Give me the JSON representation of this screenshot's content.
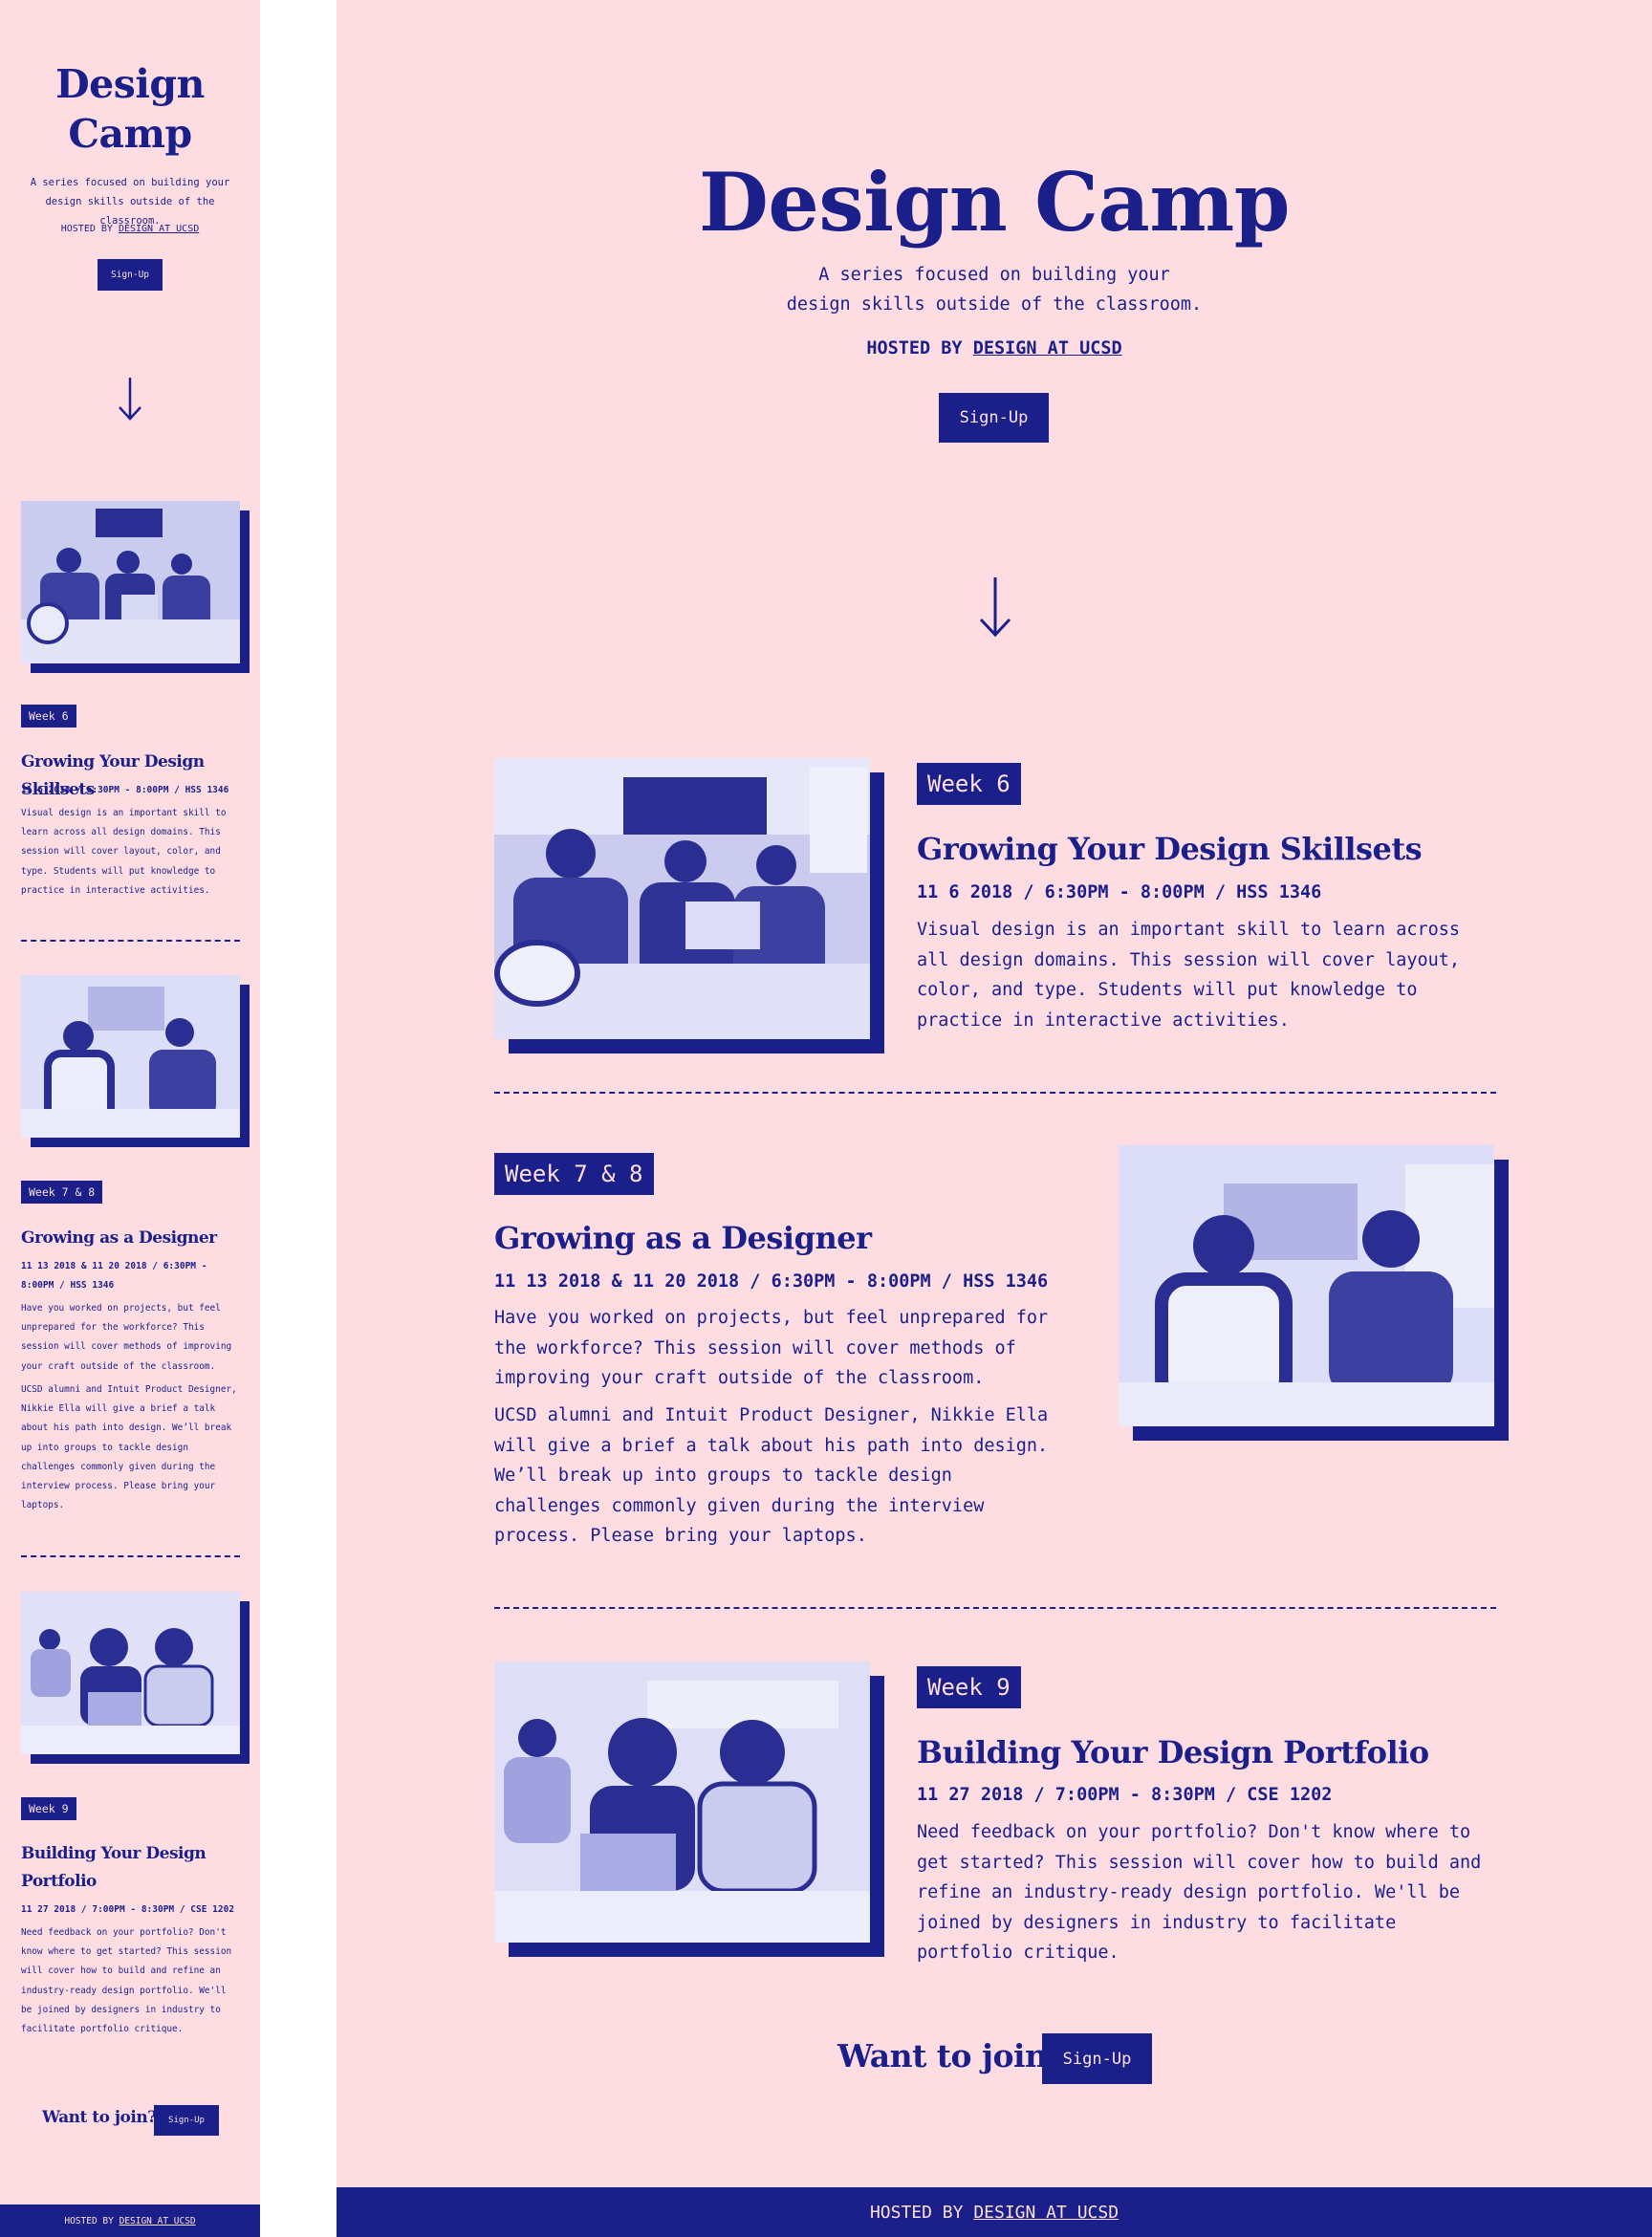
{
  "brand": {
    "primary": "#1b1f8a",
    "background": "#fddde1",
    "on_primary": "#fde0e3"
  },
  "hero": {
    "title": "Design Camp",
    "subtitle": "A series focused on building your design skills outside of the classroom.",
    "hosted_prefix": "HOSTED BY ",
    "hosted_link": "DESIGN AT UCSD",
    "signup_label": "Sign-Up",
    "scroll_icon": "arrow-down-icon"
  },
  "sessions": [
    {
      "week": "Week 6",
      "title": "Growing Your Design Skillsets",
      "meta": "11 6 2018 / 6:30PM - 8:00PM / HSS 1346",
      "description": "Visual design is an important skill to learn across all design domains. This session will cover layout, color, and type. Students will put knowledge to practice in interactive activities.",
      "description_2": ""
    },
    {
      "week": "Week 7 & 8",
      "title": "Growing as a Designer",
      "meta": "11 13 2018 & 11 20 2018 / 6:30PM - 8:00PM / HSS 1346",
      "description": "Have you worked on projects, but feel unprepared for the workforce? This session will cover methods of improving your craft outside of the classroom.",
      "description_2": "UCSD alumni and Intuit Product Designer, Nikkie Ella will give a brief a talk about his path into design. We’ll break up into groups to tackle design challenges commonly given during the interview process. Please bring your laptops."
    },
    {
      "week": "Week 9",
      "title": "Building Your Design Portfolio",
      "meta": "11 27 2018 / 7:00PM - 8:30PM / CSE 1202",
      "description": "Need feedback on your portfolio? Don't know where to get started? This session will cover how to build and refine an industry-ready design portfolio. We'll be joined by designers in industry to facilitate portfolio critique.",
      "description_2": ""
    }
  ],
  "cta": {
    "text": "Want to join?",
    "button_label": "Sign-Up"
  },
  "footer": {
    "hosted_prefix": "HOSTED BY ",
    "hosted_link": "DESIGN AT UCSD"
  }
}
